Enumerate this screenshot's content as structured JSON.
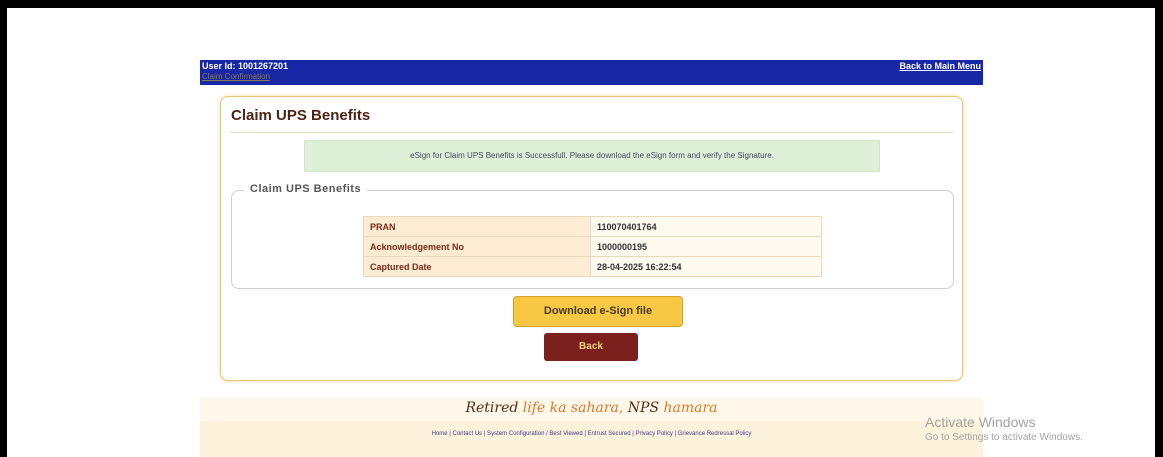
{
  "header": {
    "user_id": "User Id: 1001267201",
    "sub_link": "Claim Confirmation",
    "back_to_main_menu": "Back to Main Menu"
  },
  "card": {
    "title": "Claim UPS Benefits",
    "alert": "eSign for Claim UPS Benefits is Successfull. Please download the eSign form and verify the Signature."
  },
  "fieldset": {
    "legend": "Claim UPS Benefits",
    "rows": [
      {
        "label": "PRAN",
        "value": "110070401764"
      },
      {
        "label": "Acknowledgement No",
        "value": "1000000195"
      },
      {
        "label": "Captured Date",
        "value": "28-04-2025 16:22:54"
      }
    ]
  },
  "buttons": {
    "download": "Download e-Sign file",
    "back": "Back"
  },
  "footer": {
    "slogan_part1": "Retired ",
    "slogan_part2": "life ka sahara, ",
    "slogan_part3": "NPS ",
    "slogan_part4": "hamara",
    "links": "Home | Contact Us | System Configuration / Best Viewed | Entrust Secured | Privacy Policy | Grievance Redressal Policy"
  },
  "watermark": {
    "title": "Activate Windows",
    "subtitle": "Go to Settings to activate Windows."
  },
  "colors": {
    "topbar": "#1827a5",
    "title": "#4d2416",
    "download_button": "#f7c843",
    "back_button": "#7a1f1b",
    "alert_bg": "#dff0d8"
  }
}
